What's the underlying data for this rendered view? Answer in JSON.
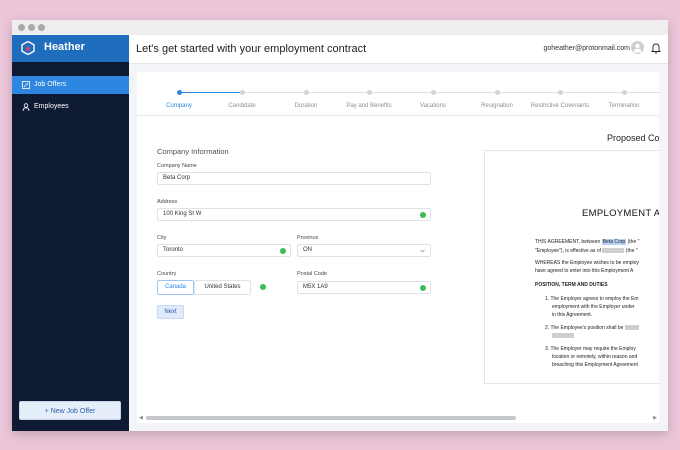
{
  "app": {
    "name": "Heather"
  },
  "sidebar": {
    "items": [
      {
        "label": "Job Offers",
        "icon": "edit-icon",
        "active": true
      },
      {
        "label": "Employees",
        "icon": "user-icon",
        "active": false
      }
    ],
    "new_job_offer": "+  New Job Offer"
  },
  "header": {
    "title": "Let's get started with your employment contract",
    "email": "goheather@protonmail.com"
  },
  "stepper": {
    "steps": [
      "Company",
      "Candidate",
      "Duration",
      "Pay and Benefits",
      "Vacations",
      "Resignation",
      "Restrictive Covenants",
      "Termination"
    ],
    "current": "Company"
  },
  "form": {
    "section_title": "Company Information",
    "company_name": {
      "label": "Company Name",
      "value": "Beta Corp"
    },
    "address": {
      "label": "Address",
      "value": "100 King St W"
    },
    "city": {
      "label": "City",
      "value": "Toronto"
    },
    "province": {
      "label": "Province",
      "value": "ON"
    },
    "country": {
      "label": "Country",
      "options": [
        "Canada",
        "United States"
      ],
      "selected": "Canada"
    },
    "postal_code": {
      "label": "Postal Code",
      "value": "M5X 1A9"
    },
    "next": "Next"
  },
  "preview": {
    "heading": "Proposed Co",
    "doc_title": "EMPLOYMENT A",
    "p1_a": "THIS AGREEMENT, between",
    "p1_company": "Beta Corp",
    "p1_b": "(the \"",
    "p1_line2a": "\"Employee\"), is effective as of",
    "p1_line2b": "(the \"",
    "p2_line1": "WHEREAS the Employee wishes to be employ",
    "p2_line2": "have agreed to enter into this Employment A",
    "section": "POSITION, TERM AND DUTIES",
    "item1_l1": "1.  The Employer agrees to employ the Em",
    "item1_l2": "employment with the Employer under",
    "item1_l3": "in this Agreement.",
    "item2_l1": "2.  The Employee's position shall be",
    "item3_l1": "3.  The Employer may require the Employ",
    "item3_l2": "location or remotely, within reason and",
    "item3_l3": "breaching this Employment Agreement"
  },
  "colors": {
    "brand": "#1f6dbd",
    "sidebar": "#0f1b33",
    "active_nav": "#2d86df",
    "valid": "#3dbb54"
  }
}
